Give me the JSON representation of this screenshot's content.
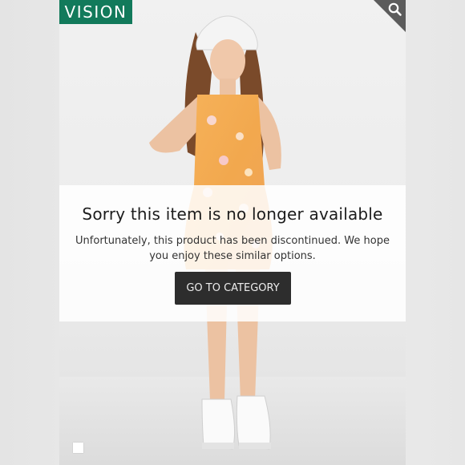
{
  "brand": {
    "name": "VISION",
    "color": "#127a5b"
  },
  "icons": {
    "zoom": "search-icon"
  },
  "notice": {
    "title": "Sorry this item is no longer available",
    "message": "Unfortunately, this product has been discontinued. We hope you enjoy these similar options.",
    "button_label": "GO TO CATEGORY"
  },
  "gallery": {
    "indicator": "image-thumbnail"
  }
}
